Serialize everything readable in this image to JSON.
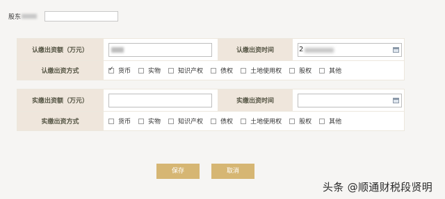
{
  "shareholder": {
    "label": "股东"
  },
  "subscribed": {
    "amount_label": "认缴出资额（万元）",
    "date_label": "认缴出资时间",
    "date_value_prefix": "2",
    "method_label": "认缴出资方式",
    "options": [
      {
        "label": "货币",
        "checked": true
      },
      {
        "label": "实物",
        "checked": false
      },
      {
        "label": "知识产权",
        "checked": false
      },
      {
        "label": "债权",
        "checked": false
      },
      {
        "label": "土地使用权",
        "checked": false
      },
      {
        "label": "股权",
        "checked": false
      },
      {
        "label": "其他",
        "checked": false
      }
    ]
  },
  "paid": {
    "amount_label": "实缴出资额（万元）",
    "date_label": "实缴出资时间",
    "method_label": "实缴出资方式",
    "options": [
      {
        "label": "货币",
        "checked": false
      },
      {
        "label": "实物",
        "checked": false
      },
      {
        "label": "知识产权",
        "checked": false
      },
      {
        "label": "债权",
        "checked": false
      },
      {
        "label": "土地使用权",
        "checked": false
      },
      {
        "label": "股权",
        "checked": false
      },
      {
        "label": "其他",
        "checked": false
      }
    ]
  },
  "buttons": {
    "save": "保存",
    "cancel": "取消"
  },
  "watermark": "头条 @顺通财税段贤明",
  "colors": {
    "label_bg": "#efe6dc",
    "button_bg": "#d6b673"
  }
}
